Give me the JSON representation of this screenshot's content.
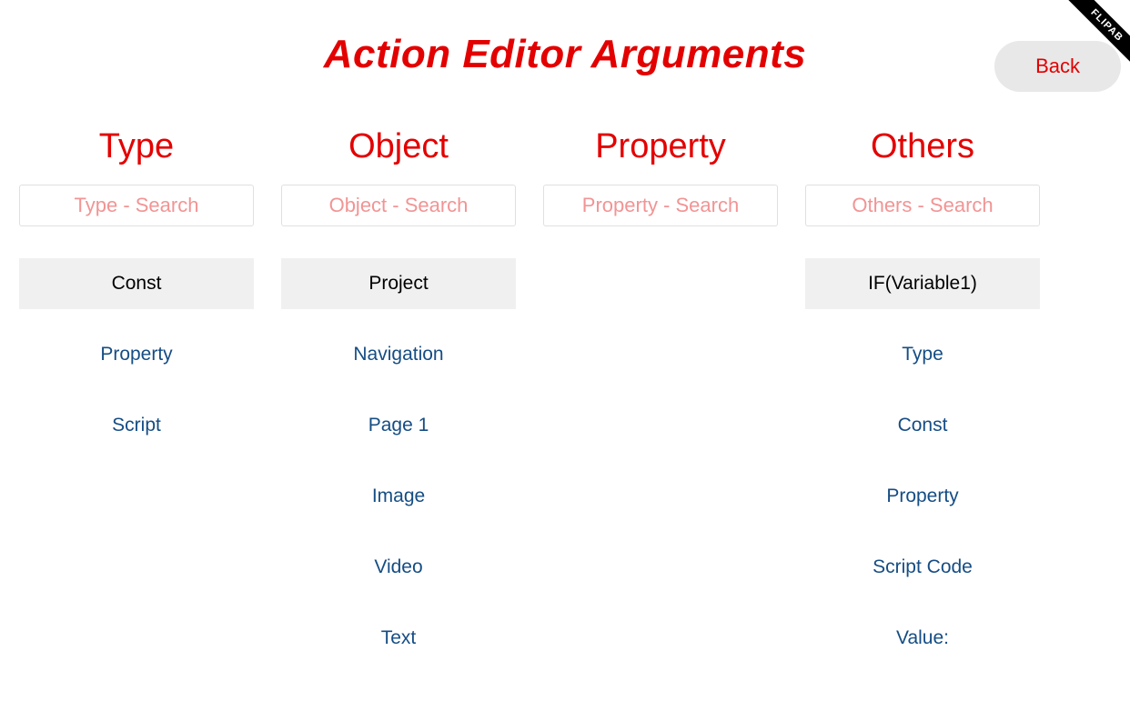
{
  "title": "Action Editor Arguments",
  "back_label": "Back",
  "ribbon_text": "FLIPAB",
  "columns": [
    {
      "header": "Type",
      "search_placeholder": "Type - Search",
      "items": [
        {
          "label": "Const",
          "selected": true
        },
        {
          "label": "Property",
          "selected": false
        },
        {
          "label": "Script",
          "selected": false
        }
      ]
    },
    {
      "header": "Object",
      "search_placeholder": "Object - Search",
      "items": [
        {
          "label": "Project",
          "selected": true
        },
        {
          "label": "Navigation",
          "selected": false
        },
        {
          "label": "Page 1",
          "selected": false
        },
        {
          "label": "Image",
          "selected": false
        },
        {
          "label": "Video",
          "selected": false
        },
        {
          "label": "Text",
          "selected": false
        }
      ]
    },
    {
      "header": "Property",
      "search_placeholder": "Property - Search",
      "items": []
    },
    {
      "header": "Others",
      "search_placeholder": "Others - Search",
      "items": [
        {
          "label": "IF(Variable1)",
          "selected": true
        },
        {
          "label": "Type",
          "selected": false
        },
        {
          "label": "Const",
          "selected": false
        },
        {
          "label": "Property",
          "selected": false
        },
        {
          "label": "Script Code",
          "selected": false
        },
        {
          "label": "Value:",
          "selected": false
        }
      ]
    }
  ]
}
